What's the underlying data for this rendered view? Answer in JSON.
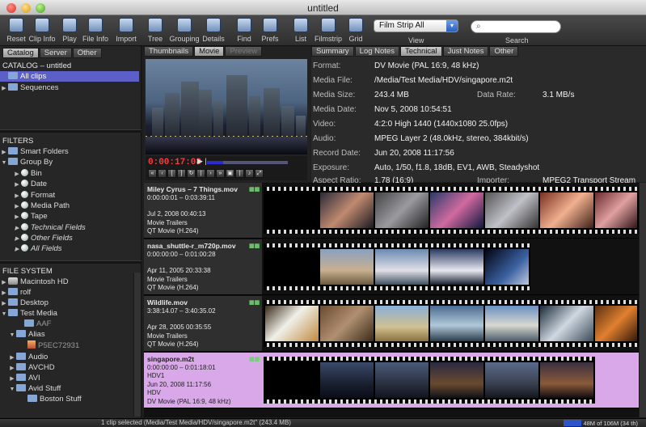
{
  "window": {
    "title": "untitled"
  },
  "toolbar": {
    "buttons": [
      "Reset",
      "Clip Info",
      "Play",
      "File Info",
      "Import",
      "Tree",
      "Grouping",
      "Details",
      "Find",
      "Prefs",
      "List",
      "Filmstrip",
      "Grid"
    ],
    "view_value": "Film Strip All",
    "view_label": "View",
    "search_label": "Search",
    "search_placeholder": ""
  },
  "sidebar": {
    "tabs": [
      "Catalog",
      "Server",
      "Other"
    ],
    "catalog_header": "CATALOG – untitled",
    "catalog_items": [
      "All clips",
      "Sequences"
    ],
    "filters_header": "FILTERS",
    "filter_items": [
      "Smart Folders",
      "Group By",
      "Bin",
      "Date",
      "Format",
      "Media Path",
      "Tape",
      "Technical Fields",
      "Other Fields",
      "All Fields"
    ],
    "fs_header": "FILE SYSTEM",
    "fs_items": [
      "Macintosh HD",
      "rolf",
      "Desktop",
      "Test Media",
      "AAF",
      "Alias",
      "P5EC72931",
      "Audio",
      "AVCHD",
      "AVI",
      "Avid Stuff",
      "Boston Stuff"
    ]
  },
  "viewer": {
    "tabs": [
      "Thumbnails",
      "Movie",
      "Preview"
    ],
    "timecode": "0:00:17:08"
  },
  "info": {
    "tabs": [
      "Summary",
      "Log Notes",
      "Technical",
      "Just Notes",
      "Other"
    ],
    "rows": [
      {
        "k": "Format:",
        "v": "DV Movie (PAL 16:9, 48 kHz)",
        "k2": "",
        "v2": ""
      },
      {
        "k": "Media File:",
        "v": "/Media/Test Media/HDV/singapore.m2t",
        "k2": "",
        "v2": ""
      },
      {
        "k": "Media Size:",
        "v": "243.4 MB",
        "k2": "Data Rate:",
        "v2": "3.1 MB/s"
      },
      {
        "k": "Media Date:",
        "v": "Nov 5, 2008 10:54:51",
        "k2": "",
        "v2": ""
      },
      {
        "k": "Video:",
        "v": "4:2:0 High 1440 (1440x1080 25.0fps)",
        "k2": "",
        "v2": ""
      },
      {
        "k": "Audio:",
        "v": "MPEG Layer 2 (48.0kHz, stereo, 384kbit/s)",
        "k2": "",
        "v2": ""
      },
      {
        "k": "Record Date:",
        "v": "Jun 20, 2008 11:17:56",
        "k2": "",
        "v2": ""
      },
      {
        "k": "Exposure:",
        "v": "Auto, 1/50, f1.8, 18dB, EV1, AWB, Steadyshot",
        "k2": "",
        "v2": ""
      },
      {
        "k": "Aspect Ratio:",
        "v": "1.78 (16:9)",
        "k2": "Importer:",
        "v2": "MPEG2 Transport Stream"
      }
    ]
  },
  "clips": [
    {
      "name": "Miley Cyrus – 7 Things.mov",
      "tc": "0:00:00:01 – 0:03:39:11",
      "date": "Jul 2, 2008 00:40:13",
      "bin": "Movie Trailers",
      "fmt": "QT Movie (H.264)"
    },
    {
      "name": "nasa_shuttle-r_m720p.mov",
      "tc": "0:00:00:00 – 0:01:00:28",
      "date": "Apr 11, 2005 20:33:38",
      "bin": "Movie Trailers",
      "fmt": "QT Movie (H.264)"
    },
    {
      "name": "Wildlife.mov",
      "tc": "3:38:14.07 – 3:40:35.02",
      "date": "Apr 28, 2005 00:35:55",
      "bin": "Movie Trailers",
      "fmt": "QT Movie (H.264)"
    },
    {
      "name": "singapore.m2t",
      "tc": "0:00:00:00 – 0:01:18:01",
      "extra1": "HDV1",
      "date": "Jun 20, 2008 11:17:56",
      "bin": "HDV",
      "fmt": "DV Movie (PAL 16:9, 48 kHz)"
    }
  ],
  "status": {
    "text": "1 clip selected (Media/Test Media/HDV/singapore.m2t\" (243.4 MB)",
    "memory": "48M of 106M (34 th)"
  },
  "colors": {
    "selection": "#5b5fc7",
    "selected_clip": "#d9a8e8",
    "timecode": "#ff3a3a"
  }
}
